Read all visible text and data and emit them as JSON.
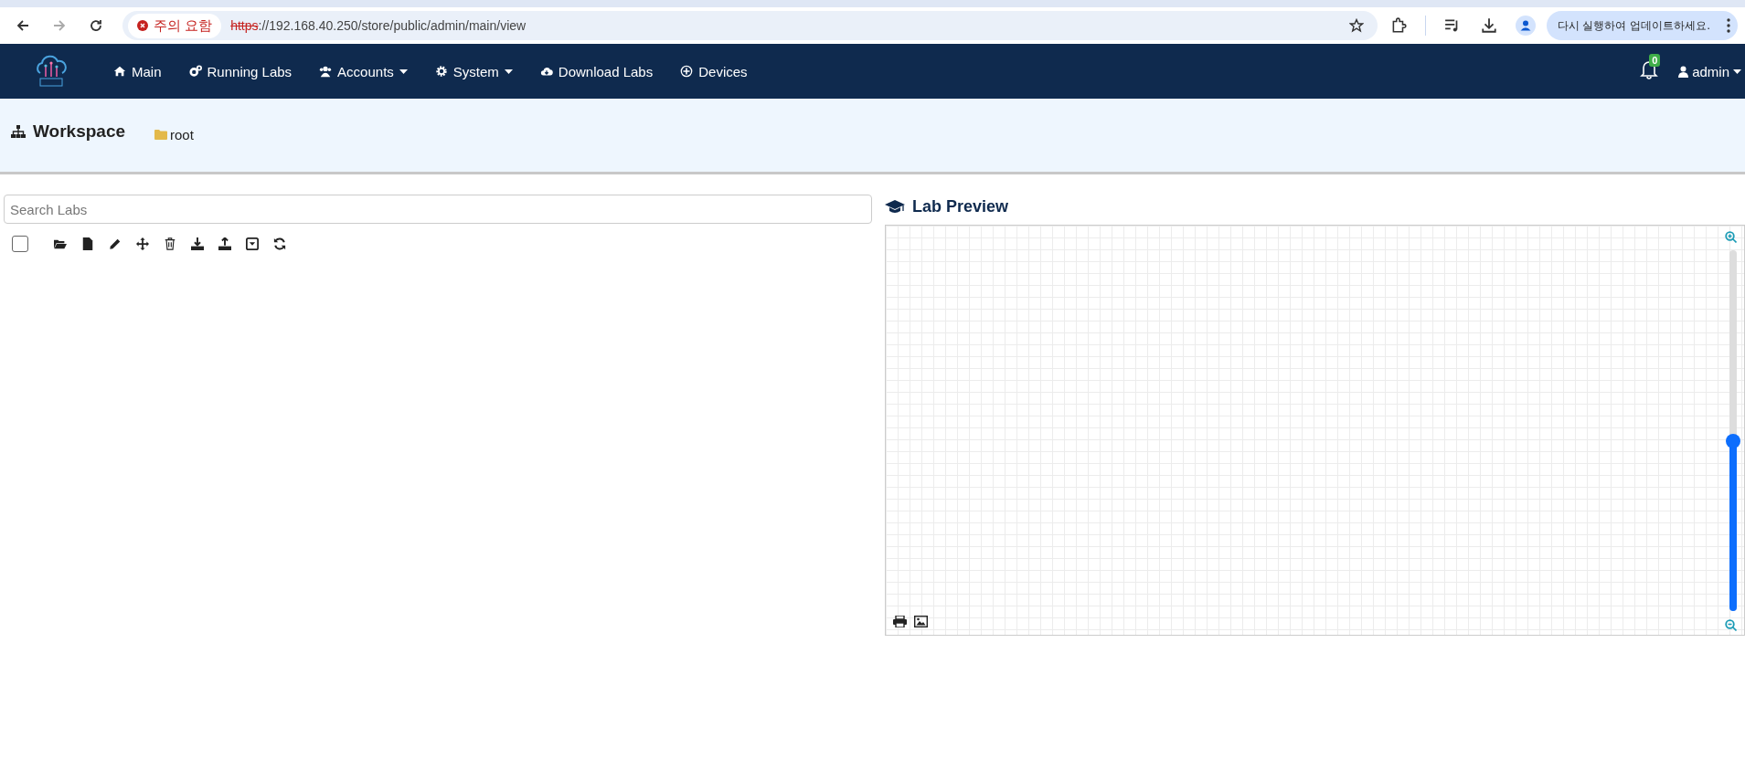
{
  "browser": {
    "security_chip": "주의 요함",
    "url_scheme": "https",
    "url_rest": "://192.168.40.250/store/public/admin/main/view",
    "update_button": "다시 실행하여 업데이트하세요."
  },
  "navbar": {
    "items": [
      {
        "label": "Main",
        "dropdown": false
      },
      {
        "label": "Running Labs",
        "dropdown": false
      },
      {
        "label": "Accounts",
        "dropdown": true
      },
      {
        "label": "System",
        "dropdown": true
      },
      {
        "label": "Download Labs",
        "dropdown": false
      },
      {
        "label": "Devices",
        "dropdown": false
      }
    ],
    "notification_count": "0",
    "user": "admin"
  },
  "workspace": {
    "title": "Workspace",
    "folder": "root"
  },
  "search": {
    "placeholder": "Search Labs"
  },
  "toolbar": {
    "select_all_checked": false
  },
  "preview": {
    "title": "Lab Preview",
    "zoom": {
      "level": 0.47
    }
  }
}
